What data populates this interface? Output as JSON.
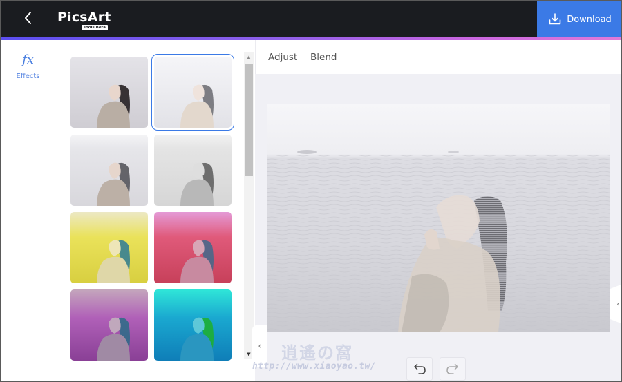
{
  "app": {
    "logo_text": "PicsArt",
    "logo_badge": "Tools Beta",
    "back_icon": "chevron-left-icon"
  },
  "header": {
    "download_label": "Download",
    "download_icon": "download-icon",
    "accent_color": "#3b7ae6"
  },
  "rail": {
    "items": [
      {
        "icon": "fx-icon",
        "glyph": "fx",
        "label": "Effects",
        "active": true
      }
    ]
  },
  "effects": {
    "thumbnails": [
      {
        "name": "original",
        "selected": false,
        "tint": "none"
      },
      {
        "name": "double-exposure-sea-light",
        "selected": true,
        "tint": "light"
      },
      {
        "name": "double-exposure-sea-clouds",
        "selected": false,
        "tint": "clouds"
      },
      {
        "name": "double-exposure-sea-gray",
        "selected": false,
        "tint": "gray"
      },
      {
        "name": "double-exposure-yellow",
        "selected": false,
        "tint": "yellow"
      },
      {
        "name": "double-exposure-red-pink",
        "selected": false,
        "tint": "red"
      },
      {
        "name": "double-exposure-purple",
        "selected": false,
        "tint": "purple"
      },
      {
        "name": "double-exposure-cyan",
        "selected": false,
        "tint": "cyan"
      }
    ]
  },
  "tabs": [
    {
      "label": "Adjust"
    },
    {
      "label": "Blend"
    }
  ],
  "canvas": {
    "undo_icon": "undo-icon",
    "redo_icon": "redo-icon"
  },
  "watermark": {
    "cjk": "逍遙の窩",
    "url": "http://www.xiaoyao.tw/"
  }
}
